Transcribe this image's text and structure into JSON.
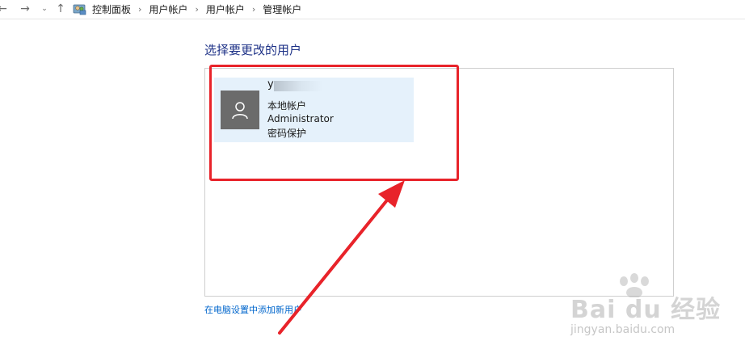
{
  "address_bar": {
    "breadcrumbs": [
      "控制面板",
      "用户帐户",
      "用户帐户",
      "管理帐户"
    ]
  },
  "page": {
    "title": "选择要更改的用户"
  },
  "user": {
    "name": "y",
    "account_type": "本地帐户",
    "role": "Administrator",
    "security": "密码保护"
  },
  "links": {
    "add_user": "在电脑设置中添加新用户"
  },
  "watermark": {
    "logo": "Bai du 经验",
    "url": "jingyan.baidu.com"
  },
  "colors": {
    "title_blue": "#1e3287",
    "link_blue": "#0066cc",
    "tile_highlight": "#e5f1fb",
    "annotation_red": "#e8232a"
  }
}
